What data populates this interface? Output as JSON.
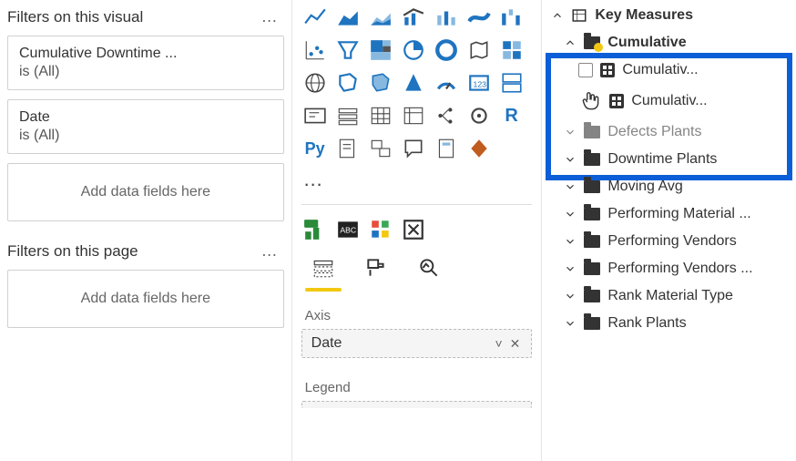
{
  "filters": {
    "visual_header": "Filters on this visual",
    "page_header": "Filters on this page",
    "cards": [
      {
        "title": "Cumulative Downtime ...",
        "sub": "is (All)"
      },
      {
        "title": "Date",
        "sub": "is (All)"
      }
    ],
    "drop_text": "Add data fields here",
    "drop_text2": "Add data fields here"
  },
  "viz": {
    "more": "…",
    "axis_label": "Axis",
    "axis_field": "Date",
    "legend_label": "Legend"
  },
  "fields": {
    "root": "Key Measures",
    "cumulative": "Cumulative",
    "cum1": "Cumulativ...",
    "cum2": "Cumulativ...",
    "defects": "Defects Plants",
    "downtime": "Downtime Plants",
    "moving": "Moving Avg",
    "perf_mat": "Performing Material ...",
    "perf_ven": "Performing Vendors",
    "perf_ven2": "Performing Vendors ...",
    "rank_mat": "Rank Material Type",
    "rank_plants": "Rank Plants"
  }
}
